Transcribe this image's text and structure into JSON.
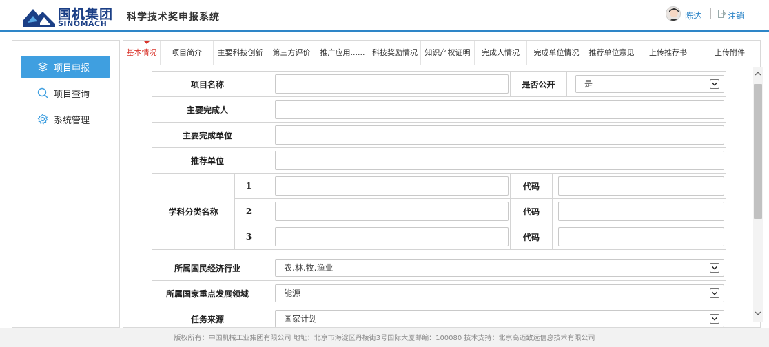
{
  "header": {
    "brand_cn": "国机集团",
    "brand_en": "SINOMACH",
    "system_title": "科学技术奖申报系统",
    "user_name": "陈达",
    "logout_label": "注销"
  },
  "sidebar": {
    "items": [
      {
        "label": "项目申报",
        "icon": "layers-icon",
        "active": true
      },
      {
        "label": "项目查询",
        "icon": "search-icon",
        "active": false
      },
      {
        "label": "系统管理",
        "icon": "gear-icon",
        "active": false
      }
    ]
  },
  "tabs": [
    {
      "label": "基本情况",
      "active": true
    },
    {
      "label": "项目简介"
    },
    {
      "label": "主要科技创新"
    },
    {
      "label": "第三方评价"
    },
    {
      "label": "推广应用......"
    },
    {
      "label": "科技奖励情况"
    },
    {
      "label": "知识产权证明"
    },
    {
      "label": "完成人情况"
    },
    {
      "label": "完成单位情况"
    },
    {
      "label": "推荐单位意见"
    },
    {
      "label": "上传推荐书"
    },
    {
      "label": "上传附件"
    }
  ],
  "form": {
    "project_name_label": "项目名称",
    "project_name_value": "",
    "is_public_label": "是否公开",
    "is_public_value": "是",
    "main_completer_label": "主要完成人",
    "main_completer_value": "",
    "main_unit_label": "主要完成单位",
    "main_unit_value": "",
    "recommend_unit_label": "推荐单位",
    "recommend_unit_value": "",
    "discipline_label": "学科分类名称",
    "code_label": "代码",
    "disciplines": [
      {
        "num": "1",
        "name": "",
        "code": ""
      },
      {
        "num": "2",
        "name": "",
        "code": ""
      },
      {
        "num": "3",
        "name": "",
        "code": ""
      }
    ],
    "industry_label": "所属国民经济行业",
    "industry_value": "农.林.牧.渔业",
    "key_field_label": "所属国家重点发展领域",
    "key_field_value": "能源",
    "task_source_label": "任务来源",
    "task_source_value": "国家计划"
  },
  "footer": {
    "text": "版权所有：中国机械工业集团有限公司 地址：北京市海淀区丹棱街3号国际大厦邮编：100080 技术支持：北京高迈致远信息技术有限公司"
  },
  "colors": {
    "accent": "#2e86c8",
    "active_tab": "#d9342b",
    "sidebar_active": "#3f9fe0",
    "brand": "#1b3f86"
  }
}
